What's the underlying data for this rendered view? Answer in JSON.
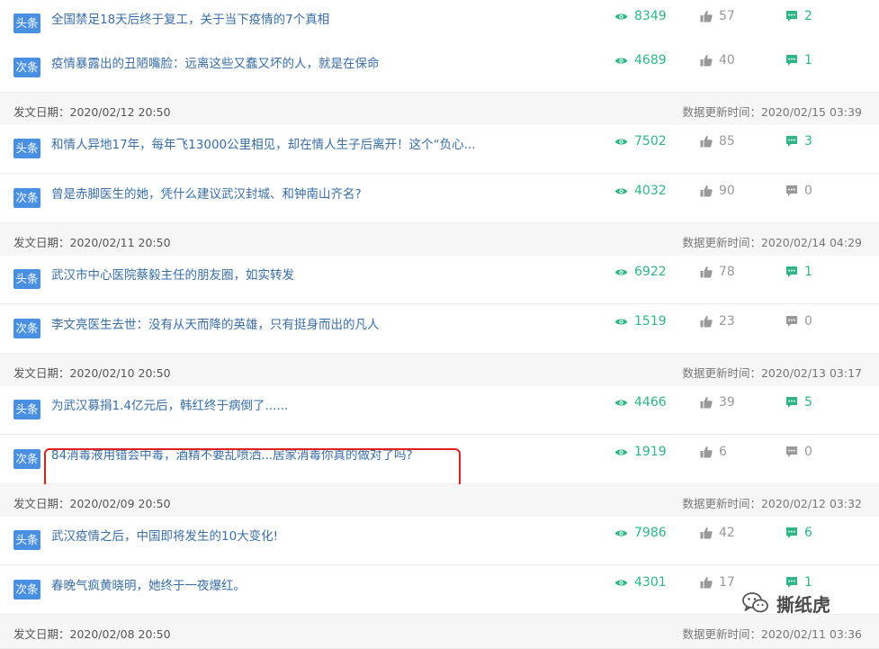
{
  "colors": {
    "badge_blue": "#4a90e2",
    "title_blue": "#3a6ea5",
    "stat_green": "#2fb684",
    "stat_gray": "#999999",
    "date_bg": "#f6f6f6",
    "highlight_red": "#e02020"
  },
  "icons": {
    "views": "eye-icon",
    "likes": "thumbs-up-icon",
    "comments": "comment-bubble-icon"
  },
  "rows": [
    {
      "type": "article",
      "badge": "头条",
      "title": "全国禁足18天后终于复工，关于当下疫情的7个真相",
      "views": "8349",
      "likes": "57",
      "comments": "2"
    },
    {
      "type": "article",
      "badge": "次条",
      "title": "疫情暴露出的丑陋嘴脸：远离这些又蠢又坏的人，就是在保命",
      "views": "4689",
      "likes": "40",
      "comments": "1"
    },
    {
      "type": "date",
      "publish_label": "发文日期：2020/02/12 20:50",
      "update_label": "数据更新时间：2020/02/15 03:39"
    },
    {
      "type": "article",
      "badge": "头条",
      "title": "和情人异地17年，每年飞13000公里相见，却在情人生子后离开！这个“负心...",
      "views": "7502",
      "likes": "85",
      "comments": "3"
    },
    {
      "type": "article",
      "badge": "次条",
      "title": "曾是赤脚医生的她，凭什么建议武汉封城、和钟南山齐名?",
      "views": "4032",
      "likes": "90",
      "comments": "0"
    },
    {
      "type": "date",
      "publish_label": "发文日期：2020/02/11 20:50",
      "update_label": "数据更新时间：2020/02/14 04:29"
    },
    {
      "type": "article",
      "badge": "头条",
      "title": "武汉市中心医院蔡毅主任的朋友圈，如实转发",
      "views": "6922",
      "likes": "78",
      "comments": "1"
    },
    {
      "type": "article",
      "badge": "次条",
      "title": "李文亮医生去世：没有从天而降的英雄，只有挺身而出的凡人",
      "views": "1519",
      "likes": "23",
      "comments": "0"
    },
    {
      "type": "date",
      "publish_label": "发文日期：2020/02/10 20:50",
      "update_label": "数据更新时间：2020/02/13 03:17"
    },
    {
      "type": "article",
      "badge": "头条",
      "title": "为武汉募捐1.4亿元后，韩红终于病倒了......",
      "views": "4466",
      "likes": "39",
      "comments": "5"
    },
    {
      "type": "article",
      "badge": "次条",
      "title": "84消毒液用错会中毒，酒精不要乱喷洒...居家消毒你真的做对了吗?",
      "views": "1919",
      "likes": "6",
      "comments": "0",
      "highlighted": true
    },
    {
      "type": "date",
      "publish_label": "发文日期：2020/02/09 20:50",
      "update_label": "数据更新时间：2020/02/12 03:32"
    },
    {
      "type": "article",
      "badge": "头条",
      "title": "武汉疫情之后，中国即将发生的10大变化!",
      "views": "7986",
      "likes": "42",
      "comments": "6"
    },
    {
      "type": "article",
      "badge": "次条",
      "title": "春晚气疯黄晓明，她终于一夜爆红。",
      "views": "4301",
      "likes": "17",
      "comments": "1"
    },
    {
      "type": "date",
      "publish_label": "发文日期：2020/02/08 20:50",
      "update_label": "数据更新时间：2020/02/11 03:36"
    }
  ],
  "watermark": {
    "text": "撕纸虎",
    "icon": "wechat-icon"
  }
}
